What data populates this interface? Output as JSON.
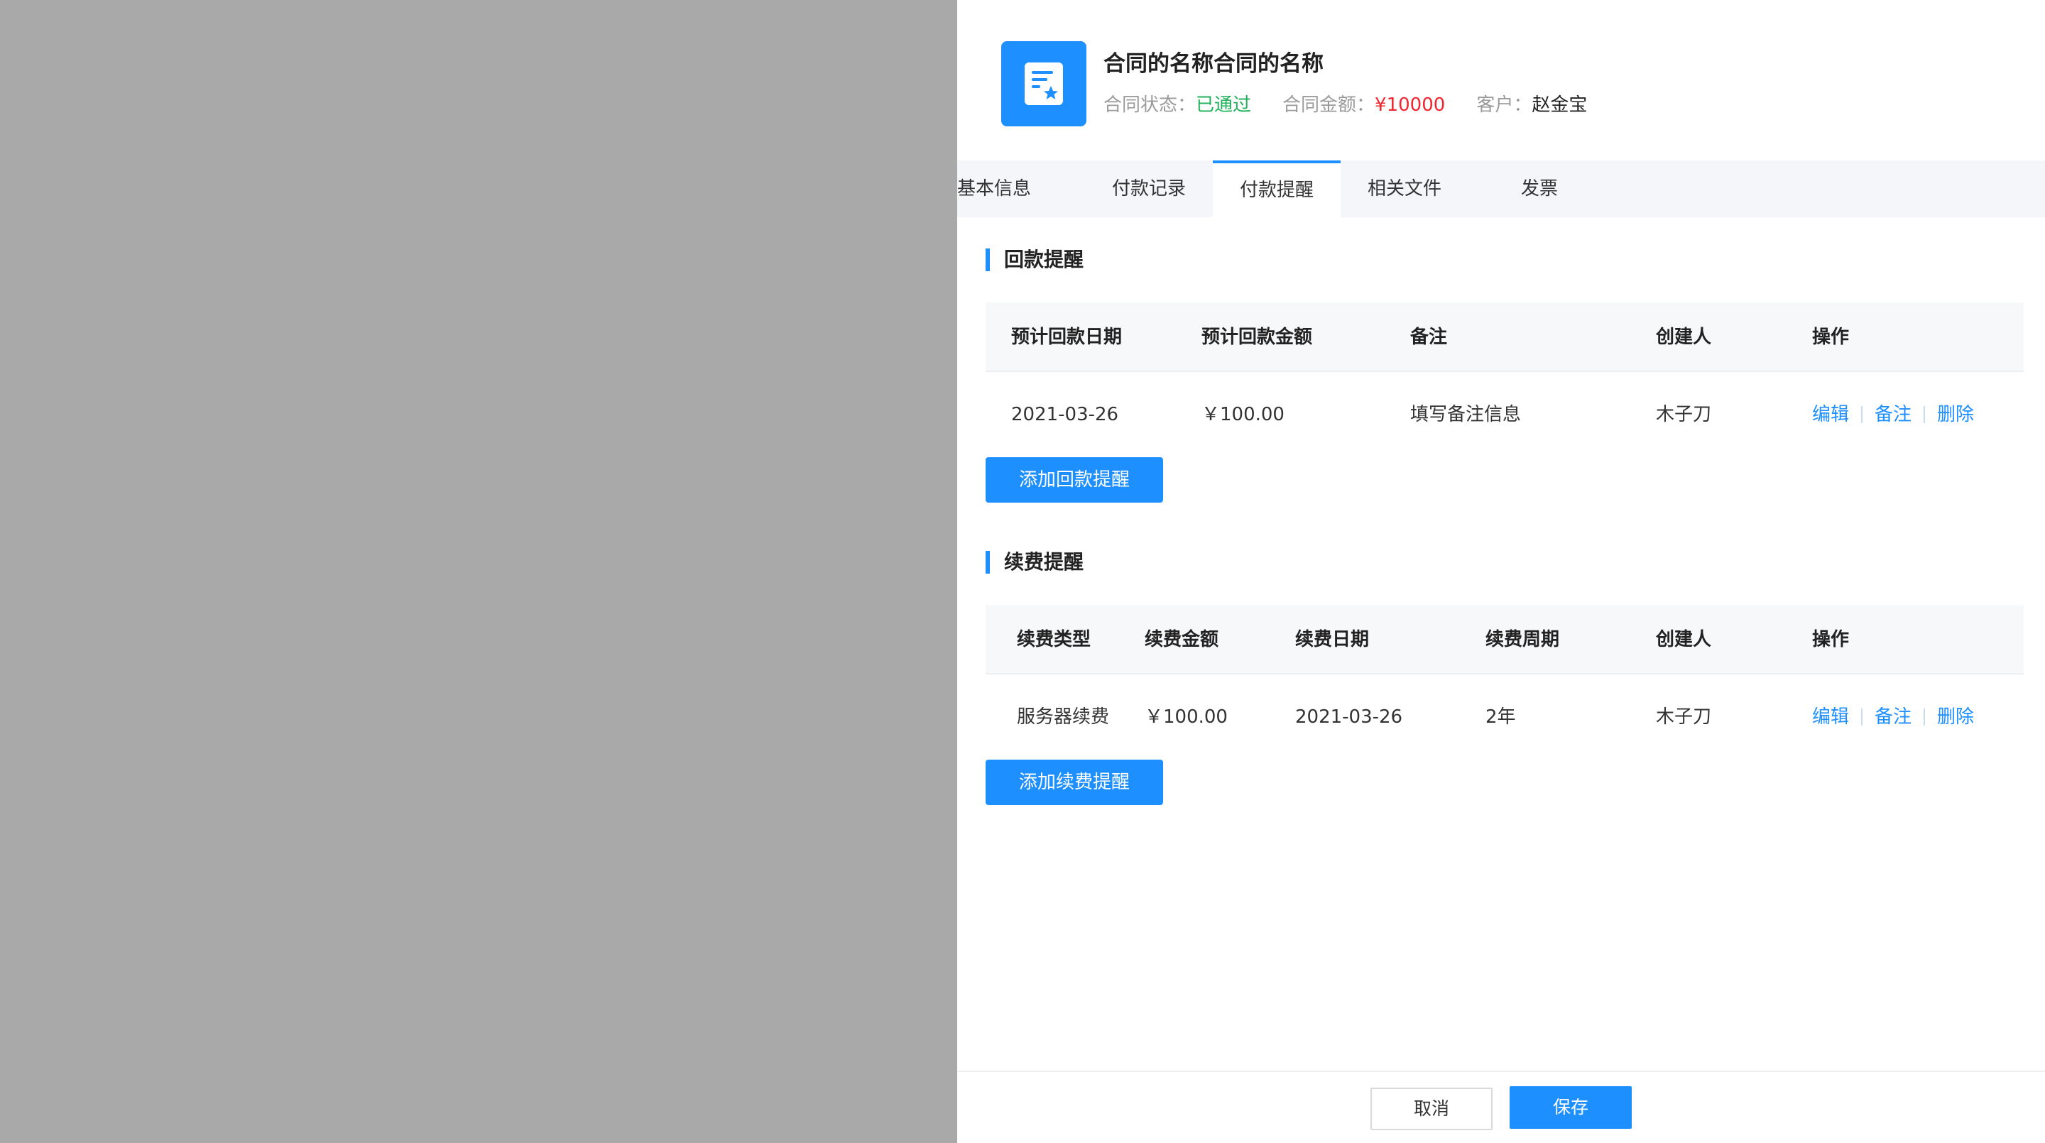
{
  "header": {
    "title": "合同的名称合同的名称",
    "status_label": "合同状态：",
    "status_value": "已通过",
    "amount_label": "合同金额：",
    "amount_value": "¥10000",
    "customer_label": "客户：",
    "customer_value": "赵金宝",
    "icon": "contract-document-star-icon"
  },
  "tabs": [
    {
      "label": "基本信息",
      "active": false
    },
    {
      "label": "付款记录",
      "active": false
    },
    {
      "label": "付款提醒",
      "active": true
    },
    {
      "label": "相关文件",
      "active": false
    },
    {
      "label": "发票",
      "active": false
    }
  ],
  "payment_reminder": {
    "title": "回款提醒",
    "columns": [
      "预计回款日期",
      "预计回款金额",
      "备注",
      "创建人",
      "操作"
    ],
    "rows": [
      {
        "date": "2021-03-26",
        "amount": "￥100.00",
        "note": "填写备注信息",
        "creator": "木子刀"
      }
    ],
    "add_button": "添加回款提醒"
  },
  "renewal_reminder": {
    "title": "续费提醒",
    "columns": [
      "续费类型",
      "续费金额",
      "续费日期",
      "续费周期",
      "创建人",
      "操作"
    ],
    "rows": [
      {
        "type": "服务器续费",
        "amount": "￥100.00",
        "date": "2021-03-26",
        "period": "2年",
        "creator": "木子刀"
      }
    ],
    "add_button": "添加续费提醒"
  },
  "row_actions": {
    "edit": "编辑",
    "note": "备注",
    "delete": "删除"
  },
  "footer": {
    "cancel": "取消",
    "save": "保存"
  },
  "colors": {
    "accent": "#1e8fff",
    "status_green": "#20b15a",
    "amount_red": "#f0262e",
    "overlay": "#a9a9a9",
    "tab_bar": "#f5f6fa"
  }
}
